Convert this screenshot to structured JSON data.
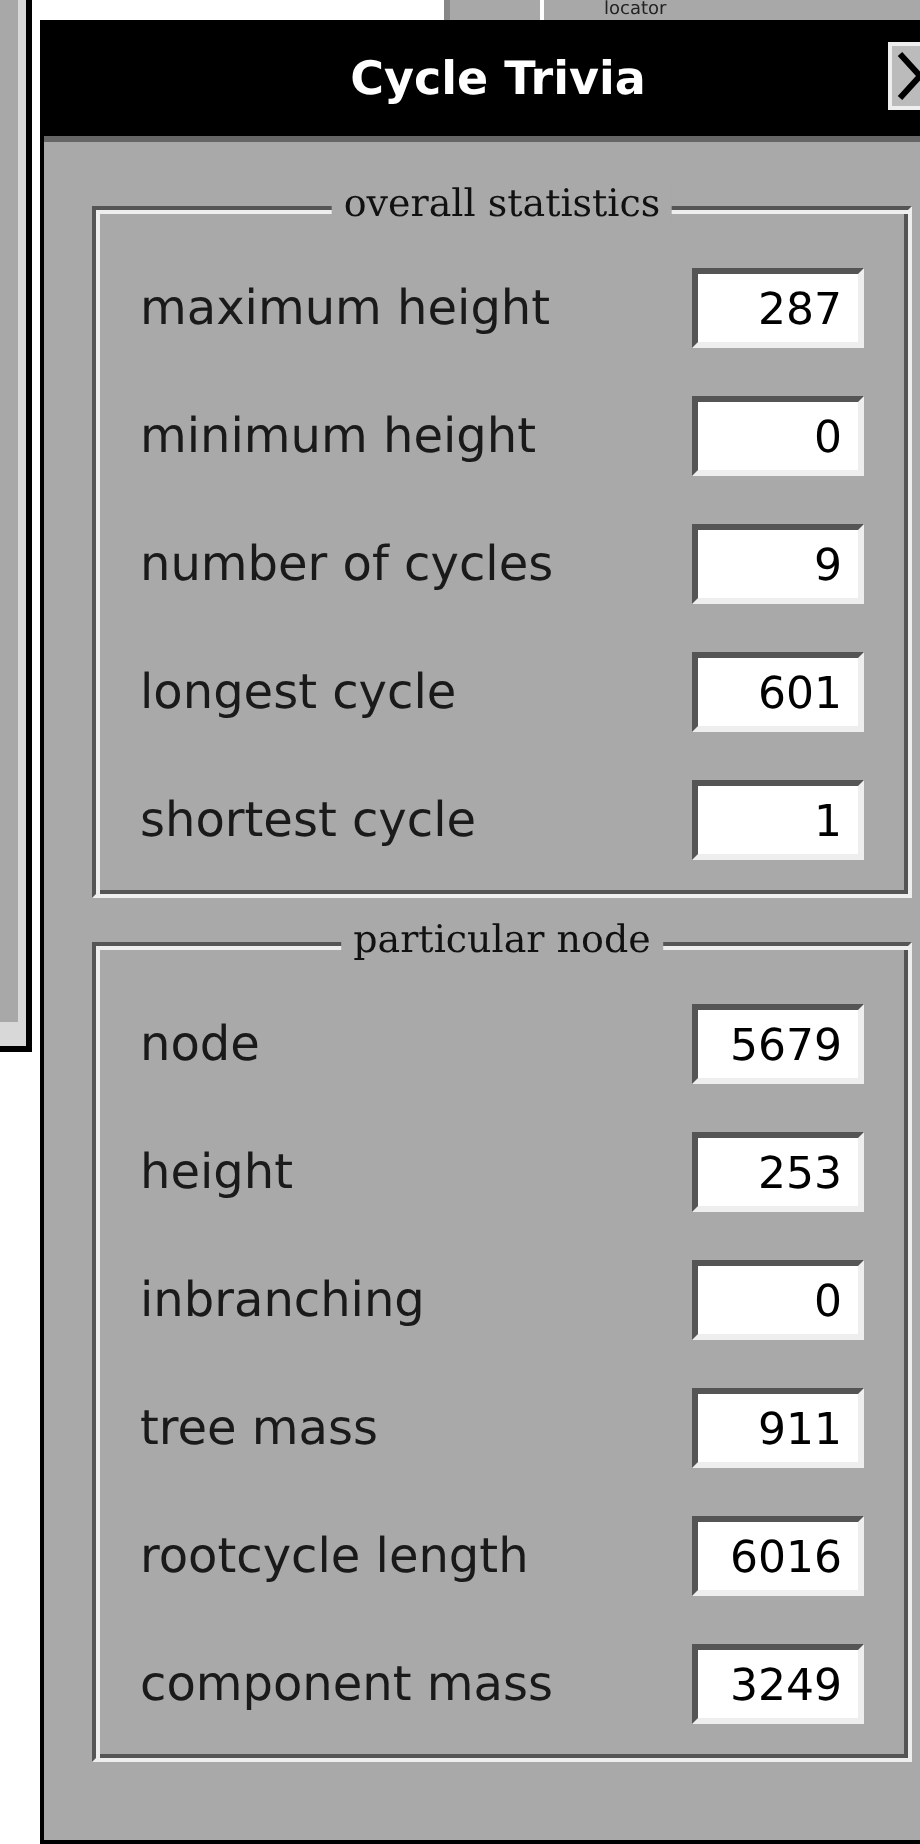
{
  "background": {
    "button_label": "locator"
  },
  "window": {
    "title": "Cycle Trivia"
  },
  "groups": [
    {
      "title": "overall statistics",
      "fields": [
        {
          "label": "maximum height",
          "value": "287"
        },
        {
          "label": "minimum height",
          "value": "0"
        },
        {
          "label": "number of cycles",
          "value": "9"
        },
        {
          "label": "longest cycle",
          "value": "601"
        },
        {
          "label": "shortest cycle",
          "value": "1"
        }
      ]
    },
    {
      "title": "particular node",
      "fields": [
        {
          "label": "node",
          "value": "5679"
        },
        {
          "label": "height",
          "value": "253"
        },
        {
          "label": "inbranching",
          "value": "0"
        },
        {
          "label": "tree mass",
          "value": "911"
        },
        {
          "label": "rootcycle length",
          "value": "6016"
        },
        {
          "label": "component mass",
          "value": "3249"
        }
      ]
    }
  ]
}
